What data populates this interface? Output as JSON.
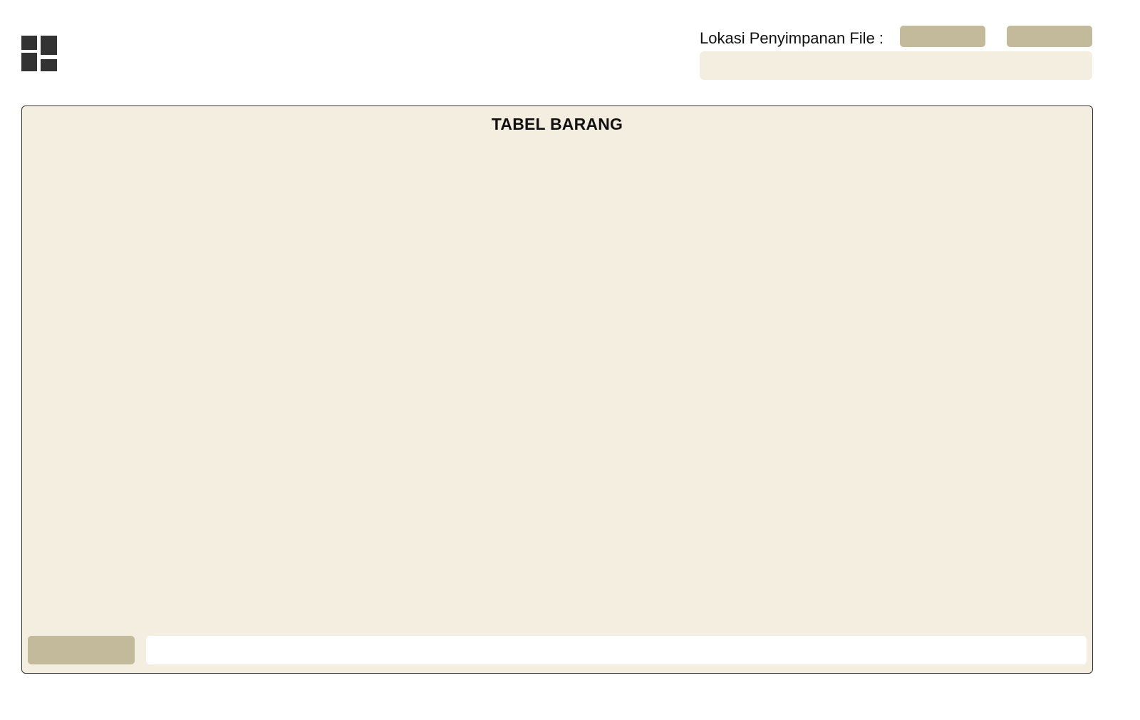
{
  "header": {
    "logo_icon": "dashboard-grid-icon",
    "logo_color": "#333333",
    "file_location_label": "Lokasi Penyimpanan File :",
    "browse_button_label": "",
    "save_button_label": "",
    "path_field_value": "",
    "path_field_placeholder": ""
  },
  "table_panel": {
    "title": "TABEL BARANG",
    "rows": [],
    "bottom_button_label": "",
    "bottom_field_value": "",
    "bottom_field_placeholder": ""
  },
  "colors": {
    "panel_background": "#f4eee0",
    "button_background": "#c3b99b",
    "field_background": "#f4eee0",
    "border": "#333333",
    "text": "#111111"
  }
}
